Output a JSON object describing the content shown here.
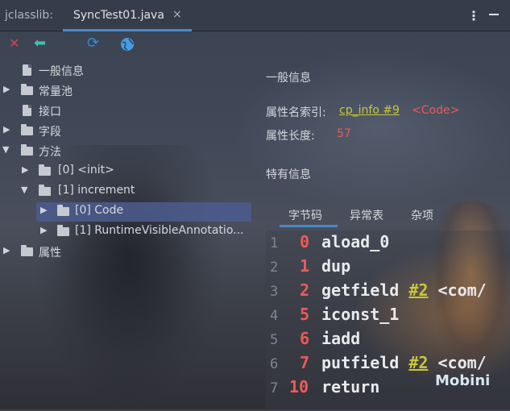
{
  "app": {
    "label": "jclasslib:"
  },
  "tabs": [
    {
      "label": "SyncTest01.java",
      "close": "×"
    }
  ],
  "window_icons": {
    "more": "⋮",
    "minimize": "minimize-icon"
  },
  "toolbar": [
    {
      "icon": "close-icon",
      "glyph": "✕",
      "color": "#e0404a"
    },
    {
      "icon": "back-arrow-icon",
      "glyph": "🡄",
      "color": "#3fc0b0"
    },
    {
      "icon": "refresh-icon",
      "glyph": "⟳",
      "color": "#2e8fd8"
    },
    {
      "icon": "browser-globe-icon",
      "glyph": "◉",
      "color": "#5aa8e8"
    }
  ],
  "tree": [
    {
      "label": "一般信息",
      "type": "file"
    },
    {
      "label": "常量池",
      "type": "folder",
      "expanded": false
    },
    {
      "label": "接口",
      "type": "file"
    },
    {
      "label": "字段",
      "type": "folder",
      "expanded": false
    },
    {
      "label": "方法",
      "type": "folder",
      "expanded": true
    },
    {
      "label": "[0] <init>",
      "type": "folder",
      "expanded": false
    },
    {
      "label": "[1] increment",
      "type": "folder",
      "expanded": true
    },
    {
      "label": "[0] Code",
      "type": "folder",
      "expanded": false,
      "selected": true
    },
    {
      "label": "[1] RuntimeVisibleAnnotatio...",
      "type": "folder",
      "expanded": false
    },
    {
      "label": "属性",
      "type": "folder",
      "expanded": false
    }
  ],
  "general": {
    "heading": "一般信息",
    "name_index_label": "属性名索引:",
    "name_index_link": "cp_info #9",
    "name_index_value": "<Code>",
    "length_label": "属性长度:",
    "length_value": "57"
  },
  "specific": {
    "heading": "特有信息"
  },
  "subtabs": [
    "字节码",
    "异常表",
    "杂项"
  ],
  "bytecode": [
    {
      "line": "1",
      "offset": "0",
      "op": "aload_0",
      "ref": "",
      "comment": ""
    },
    {
      "line": "2",
      "offset": "1",
      "op": "dup",
      "ref": "",
      "comment": ""
    },
    {
      "line": "3",
      "offset": "2",
      "op": "getfield",
      "ref": "#2",
      "comment": "<com/"
    },
    {
      "line": "4",
      "offset": "5",
      "op": "iconst_1",
      "ref": "",
      "comment": ""
    },
    {
      "line": "5",
      "offset": "6",
      "op": "iadd",
      "ref": "",
      "comment": ""
    },
    {
      "line": "6",
      "offset": "7",
      "op": "putfield",
      "ref": "#2",
      "comment": "<com/"
    },
    {
      "line": "7",
      "offset": "10",
      "op": "return",
      "ref": "",
      "comment": ""
    }
  ],
  "watermark": "Mobini"
}
